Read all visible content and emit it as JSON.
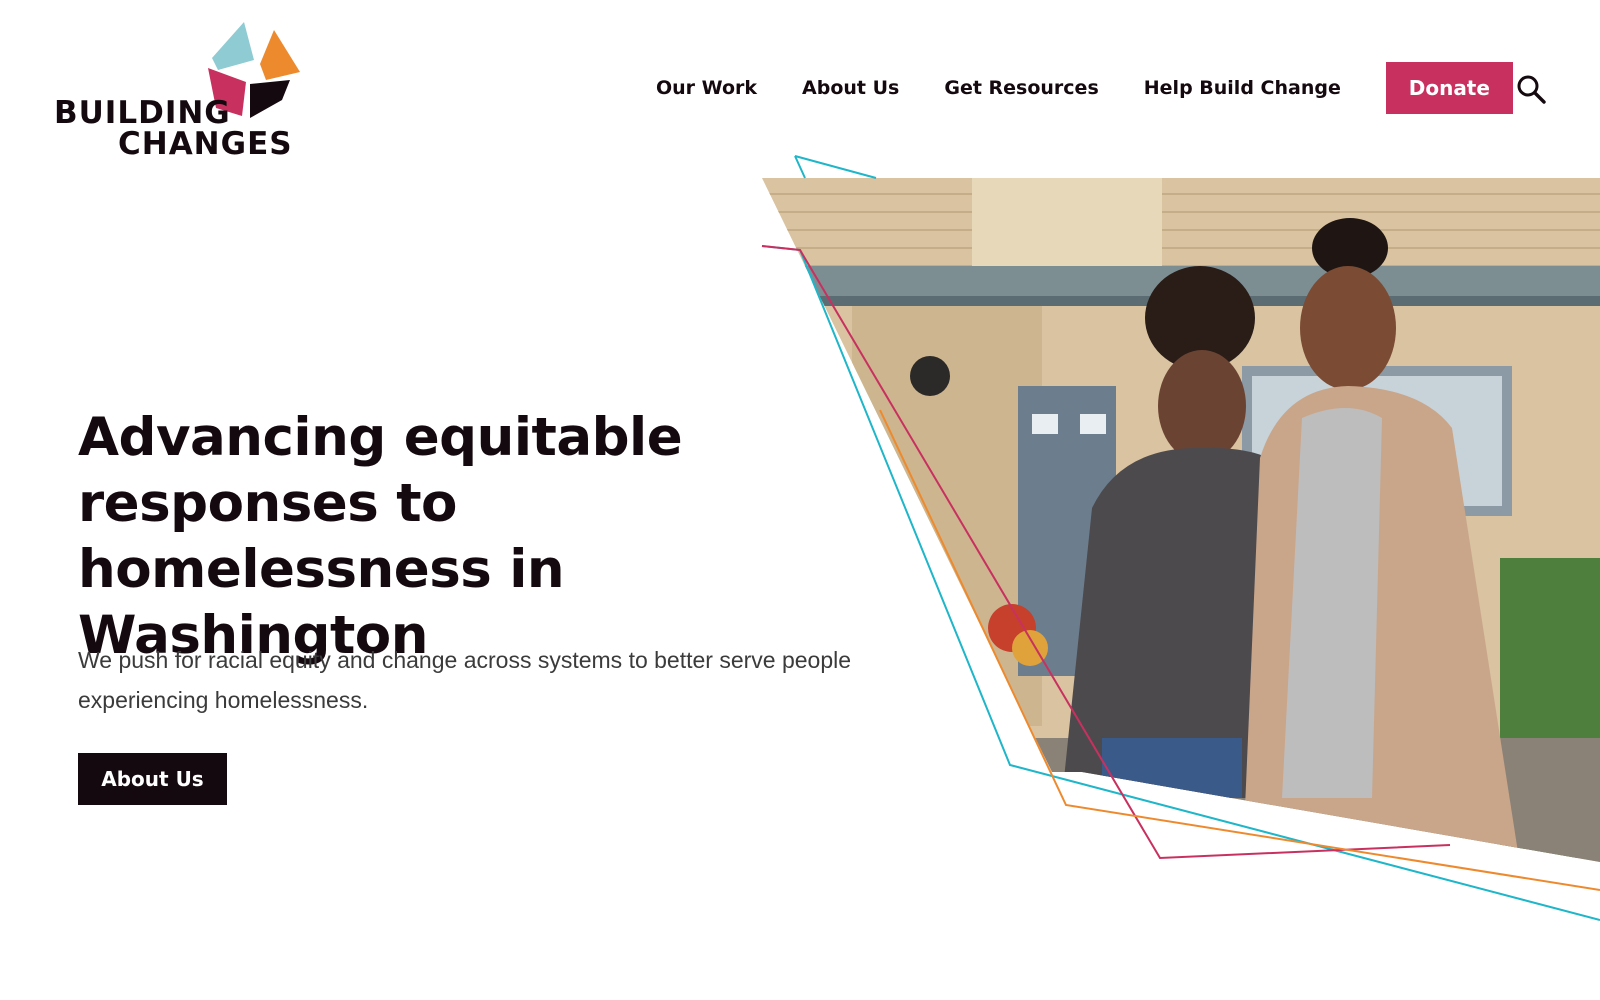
{
  "brand": {
    "line1": "BUILDING",
    "line2": "CHANGES",
    "colors": {
      "teal": "#8ecbd3",
      "orange": "#ee8a2e",
      "crimson": "#c8315f",
      "dark": "#14090f"
    }
  },
  "nav": {
    "items": [
      {
        "label": "Our Work"
      },
      {
        "label": "About Us"
      },
      {
        "label": "Get Resources"
      },
      {
        "label": "Help Build Change"
      }
    ],
    "donate_label": "Donate",
    "search_icon": "search-icon"
  },
  "hero": {
    "headline": "Advancing equitable responses to homelessness in Washington",
    "subtext": "We push for racial equity and change across systems to better serve people experiencing homelessness.",
    "cta_label": "About Us",
    "photo_alt": "photo of a woman and a girl standing in front of a house",
    "accent_colors": [
      "#1eb6c8",
      "#c8315f",
      "#ee8a2e"
    ]
  }
}
